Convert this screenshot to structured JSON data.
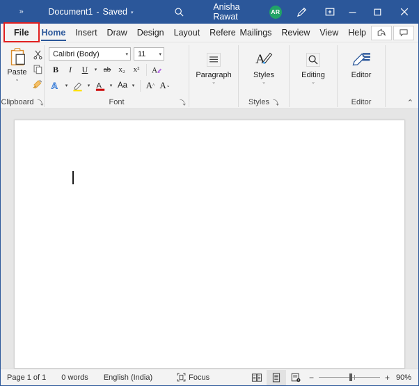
{
  "titlebar": {
    "chevrons": "»",
    "document_name": "Document1",
    "separator": "-",
    "save_state": "Saved",
    "caret": "▾",
    "search_icon": "search-icon",
    "user_name": "Anisha Rawat",
    "user_initials": "AR",
    "pen_icon": "pen-ink-icon",
    "restore_icon": "restore-down-icon",
    "minimize": "–",
    "maximize": "□",
    "close": "✕",
    "bg_color": "#2b579a",
    "avatar_color": "#21a366"
  },
  "tabs": [
    {
      "label": "File",
      "active": false,
      "is_file": true
    },
    {
      "label": "Home",
      "active": true,
      "is_file": false
    },
    {
      "label": "Insert",
      "active": false,
      "is_file": false
    },
    {
      "label": "Draw",
      "active": false,
      "is_file": false
    },
    {
      "label": "Design",
      "active": false,
      "is_file": false
    },
    {
      "label": "Layout",
      "active": false,
      "is_file": false
    },
    {
      "label": "References",
      "active": false,
      "is_file": false
    },
    {
      "label": "Mailings",
      "active": false,
      "is_file": false
    },
    {
      "label": "Review",
      "active": false,
      "is_file": false
    },
    {
      "label": "View",
      "active": false,
      "is_file": false
    },
    {
      "label": "Help",
      "active": false,
      "is_file": false
    }
  ],
  "tabbar_right": {
    "share_icon": "share-icon",
    "comments_icon": "comments-icon"
  },
  "annotation": {
    "target": "File",
    "color": "#e02020"
  },
  "ribbon": {
    "clipboard": {
      "group_label": "Clipboard",
      "launcher": "⤵",
      "paste_label": "Paste",
      "paste_caret": "⌄",
      "cut_icon": "scissors-icon",
      "copy_icon": "copy-icon",
      "format_painter_icon": "format-painter-icon"
    },
    "font": {
      "group_label": "Font",
      "launcher": "⤵",
      "font_name": "Calibri (Body)",
      "font_size": "11",
      "bold": "B",
      "italic": "I",
      "underline": "U",
      "strikethrough": "ab",
      "subscript": "x₂",
      "superscript": "x²",
      "clear_formatting": "clear-formatting-icon",
      "text_effects": "A",
      "highlight": "highlight-color-icon",
      "font_color": "A",
      "change_case": "Aa",
      "grow_font": "A",
      "shrink_font": "A",
      "caret": "⌄"
    },
    "paragraph": {
      "group_label": "",
      "label": "Paragraph",
      "caret": "⌄",
      "icon": "paragraph-icon"
    },
    "styles": {
      "group_label": "Styles",
      "launcher": "⤵",
      "label": "Styles",
      "caret": "⌄",
      "icon": "styles-icon"
    },
    "editing": {
      "label": "Editing",
      "caret": "⌄",
      "icon": "find-magnifier-icon"
    },
    "editor": {
      "group_label": "Editor",
      "label": "Editor",
      "icon": "editor-pen-icon"
    },
    "collapse": "⌃"
  },
  "document": {
    "content": "",
    "caret_visible": true
  },
  "statusbar": {
    "page_info": "Page 1 of 1",
    "word_count": "0 words",
    "language": "English (India)",
    "focus_label": "Focus",
    "focus_icon": "focus-icon",
    "views": [
      {
        "name": "read-mode",
        "selected": false
      },
      {
        "name": "print-layout",
        "selected": true
      },
      {
        "name": "web-layout",
        "selected": false
      }
    ],
    "zoom_out": "−",
    "zoom_in": "+",
    "zoom_level": "90%"
  }
}
